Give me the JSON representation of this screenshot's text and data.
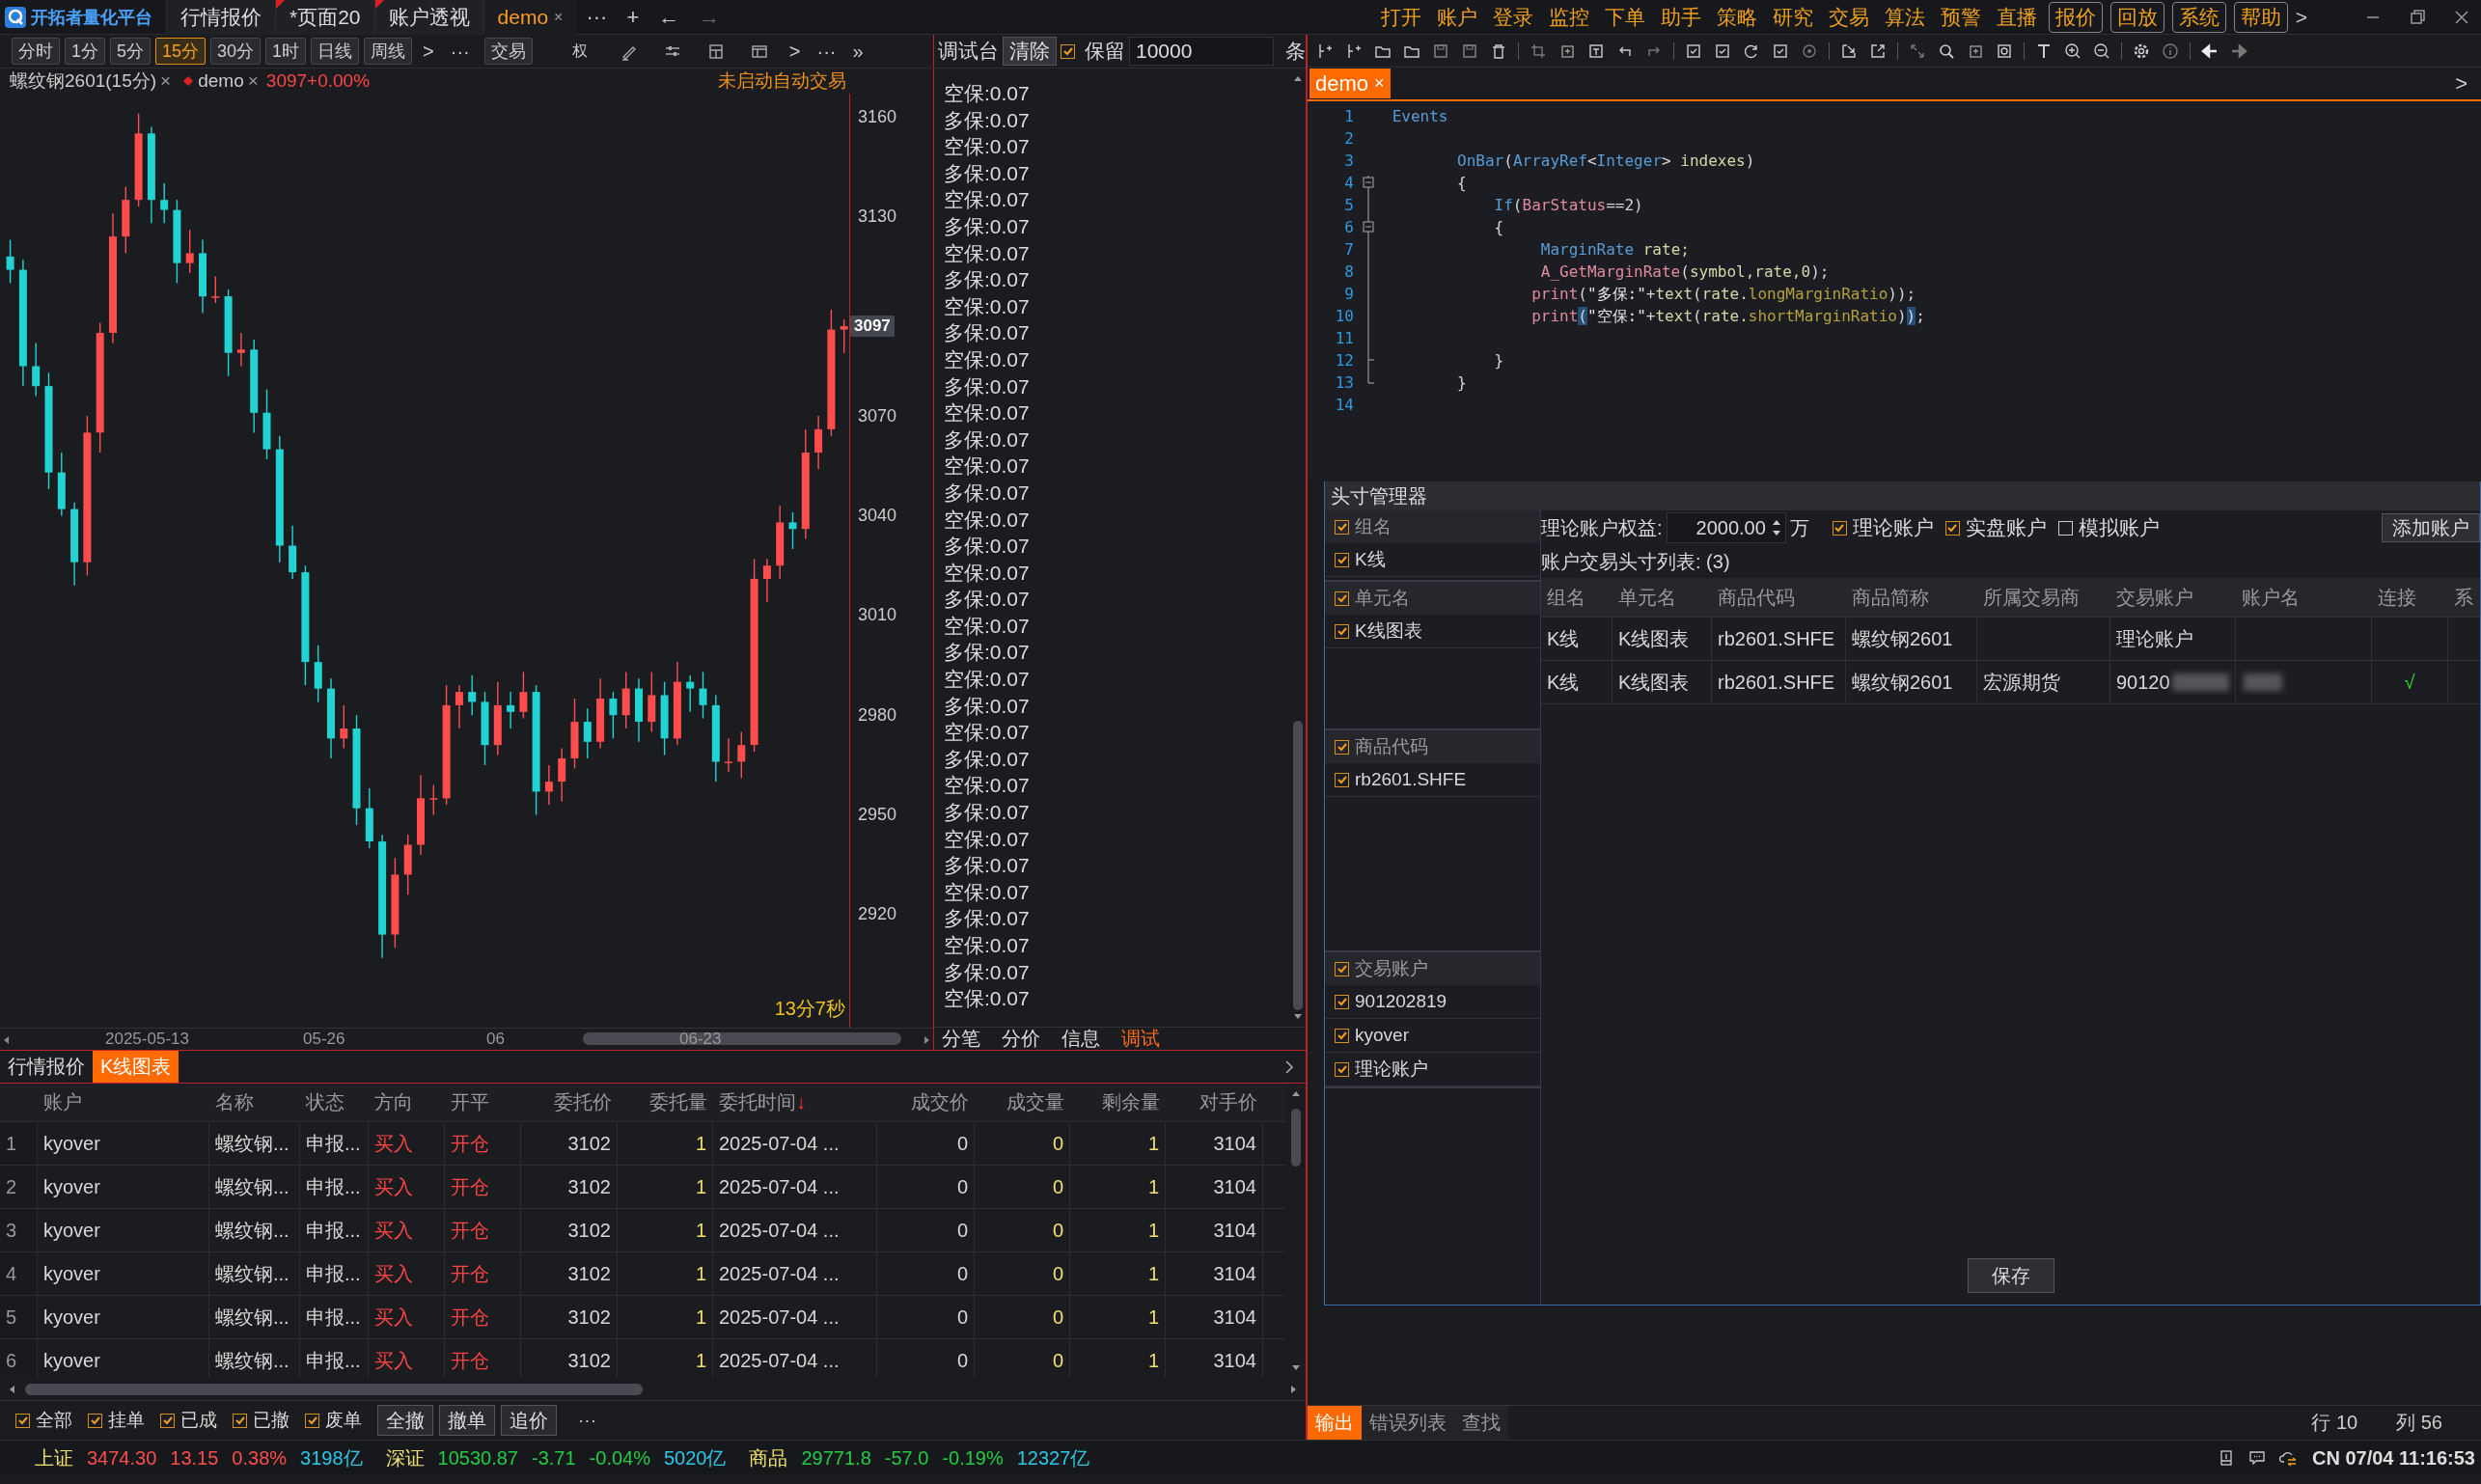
{
  "app": {
    "title": "开拓者量化平台"
  },
  "tabs": [
    {
      "label": "行情报价",
      "selected": false,
      "marked": false
    },
    {
      "label": "*页面20",
      "selected": false,
      "marked": true
    },
    {
      "label": "账户透视",
      "selected": false,
      "marked": true
    },
    {
      "label": "demo",
      "selected": true,
      "marked": false,
      "close": "×"
    }
  ],
  "tab_actions": [
    "···",
    "+",
    "←",
    "→"
  ],
  "menu": [
    {
      "label": "打开",
      "boxed": false
    },
    {
      "label": "账户",
      "boxed": false
    },
    {
      "label": "登录",
      "boxed": false
    },
    {
      "label": "监控",
      "boxed": false
    },
    {
      "label": "下单",
      "boxed": false
    },
    {
      "label": "助手",
      "boxed": false
    },
    {
      "label": "策略",
      "boxed": false
    },
    {
      "label": "研究",
      "boxed": false
    },
    {
      "label": "交易",
      "boxed": false
    },
    {
      "label": "算法",
      "boxed": false
    },
    {
      "label": "预警",
      "boxed": false
    },
    {
      "label": "直播",
      "boxed": false
    },
    {
      "label": "报价",
      "boxed": true
    },
    {
      "label": "回放",
      "boxed": true
    },
    {
      "label": "系统",
      "boxed": true
    },
    {
      "label": "帮助",
      "boxed": true
    }
  ],
  "menu_more": ">",
  "periods": [
    {
      "label": "分时",
      "selected": false
    },
    {
      "label": "1分",
      "selected": false
    },
    {
      "label": "5分",
      "selected": false
    },
    {
      "label": "15分",
      "selected": true
    },
    {
      "label": "30分",
      "selected": false
    },
    {
      "label": "1时",
      "selected": false
    },
    {
      "label": "日线",
      "selected": false
    },
    {
      "label": "周线",
      "selected": false
    }
  ],
  "chart_toolbar": {
    "more": [
      ">",
      "···"
    ],
    "trade": "交易",
    "weight": "权",
    "tail": [
      ">",
      "···",
      "»"
    ]
  },
  "debug_toolbar": {
    "title": "调试台",
    "clear": "清除",
    "keep": {
      "label": "保留",
      "checked": true
    },
    "limit": "10000",
    "unit": "条"
  },
  "chart": {
    "symbol": "螺纹钢2601(15分)",
    "close1": "×",
    "strategy": "demo",
    "close2": "×",
    "quote": "3097+0.00%",
    "auto_status": "未启动自动交易",
    "price_tag": "3097",
    "timer": "13分7秒",
    "x_labels": [
      "2025-05-13",
      "05-26",
      "06",
      "06-23"
    ],
    "chart_data": {
      "type": "candlestick",
      "ylim": [
        2886,
        3167
      ],
      "yticks": [
        {
          "value": 3160,
          "label": "3160"
        },
        {
          "value": 3130,
          "label": "3130"
        },
        {
          "value": 3070,
          "label": "3070"
        },
        {
          "value": 3040,
          "label": "3040"
        },
        {
          "value": 3010,
          "label": "3010"
        },
        {
          "value": 2980,
          "label": "2980"
        },
        {
          "value": 2950,
          "label": "2950"
        },
        {
          "value": 2920,
          "label": "2920"
        }
      ],
      "categories": [
        null,
        null,
        null,
        null,
        null,
        null,
        null,
        null,
        null,
        null,
        null,
        null,
        null,
        null,
        null,
        null,
        null,
        null,
        null,
        null,
        null,
        null,
        null,
        null,
        null,
        null,
        null,
        null,
        null,
        null,
        null,
        null,
        null,
        null,
        null,
        null,
        null,
        null,
        null,
        null,
        null,
        null,
        null,
        null,
        null,
        null,
        null,
        null,
        null,
        null,
        null,
        null,
        null,
        null,
        null,
        null,
        null,
        null,
        null,
        null,
        null,
        null,
        null,
        null,
        null,
        null
      ],
      "ohlc": [
        [
          3118,
          3123,
          3110,
          3114
        ],
        [
          3114,
          3117,
          3079,
          3085
        ],
        [
          3085,
          3092,
          3076,
          3079
        ],
        [
          3079,
          3083,
          3048,
          3053
        ],
        [
          3053,
          3059,
          3040,
          3042
        ],
        [
          3042,
          3044,
          3019,
          3026
        ],
        [
          3026,
          3070,
          3022,
          3065
        ],
        [
          3065,
          3098,
          3059,
          3095
        ],
        [
          3095,
          3131,
          3092,
          3124
        ],
        [
          3124,
          3139,
          3119,
          3135
        ],
        [
          3135,
          3161,
          3133,
          3155
        ],
        [
          3155,
          3157,
          3128,
          3135
        ],
        [
          3135,
          3140,
          3128,
          3132
        ],
        [
          3132,
          3135,
          3110,
          3116
        ],
        [
          3116,
          3126,
          3113,
          3119
        ],
        [
          3119,
          3123,
          3101,
          3106
        ],
        [
          3106,
          3112,
          3104,
          3106
        ],
        [
          3106,
          3108,
          3082,
          3089
        ],
        [
          3089,
          3095,
          3085,
          3090
        ],
        [
          3090,
          3093,
          3065,
          3071
        ],
        [
          3071,
          3078,
          3057,
          3060
        ],
        [
          3060,
          3064,
          3026,
          3031
        ],
        [
          3031,
          3037,
          3021,
          3023
        ],
        [
          3023,
          3025,
          2989,
          2996
        ],
        [
          2996,
          3001,
          2984,
          2988
        ],
        [
          2988,
          2991,
          2967,
          2973
        ],
        [
          2973,
          2983,
          2970,
          2976
        ],
        [
          2976,
          2980,
          2947,
          2952
        ],
        [
          2952,
          2958,
          2940,
          2942
        ],
        [
          2942,
          2944,
          2907,
          2914
        ],
        [
          2914,
          2937,
          2910,
          2932
        ],
        [
          2932,
          2944,
          2926,
          2941
        ],
        [
          2941,
          2962,
          2938,
          2955
        ],
        [
          2955,
          2959,
          2950,
          2955
        ],
        [
          2955,
          2989,
          2953,
          2983
        ],
        [
          2983,
          2989,
          2976,
          2987
        ],
        [
          2987,
          2992,
          2980,
          2984
        ],
        [
          2984,
          2987,
          2965,
          2971
        ],
        [
          2971,
          2990,
          2968,
          2983
        ],
        [
          2983,
          2987,
          2976,
          2981
        ],
        [
          2981,
          2993,
          2979,
          2987
        ],
        [
          2987,
          2989,
          2950,
          2957
        ],
        [
          2957,
          2965,
          2953,
          2960
        ],
        [
          2960,
          2970,
          2954,
          2967
        ],
        [
          2967,
          2985,
          2964,
          2978
        ],
        [
          2978,
          2982,
          2967,
          2972
        ],
        [
          2972,
          2991,
          2970,
          2985
        ],
        [
          2985,
          2987,
          2973,
          2980
        ],
        [
          2980,
          2993,
          2976,
          2988
        ],
        [
          2988,
          2991,
          2972,
          2978
        ],
        [
          2978,
          2993,
          2975,
          2986
        ],
        [
          2986,
          2990,
          2968,
          2973
        ],
        [
          2973,
          2996,
          2971,
          2990
        ],
        [
          2990,
          2992,
          2981,
          2988
        ],
        [
          2988,
          2993,
          2979,
          2983
        ],
        [
          2983,
          2986,
          2960,
          2966
        ],
        [
          2966,
          2973,
          2963,
          2966
        ],
        [
          2966,
          2975,
          2961,
          2971
        ],
        [
          2971,
          3027,
          2969,
          3021
        ],
        [
          3021,
          3027,
          3014,
          3025
        ],
        [
          3025,
          3043,
          3021,
          3038
        ],
        [
          3038,
          3041,
          3030,
          3036
        ],
        [
          3036,
          3066,
          3033,
          3059
        ],
        [
          3059,
          3070,
          3054,
          3066
        ],
        [
          3066,
          3102,
          3064,
          3096
        ],
        [
          3096,
          3099,
          3089,
          3097
        ]
      ]
    }
  },
  "debug_lines": [
    "空保:0.07",
    "多保:0.07",
    "空保:0.07",
    "多保:0.07",
    "空保:0.07",
    "多保:0.07",
    "空保:0.07",
    "多保:0.07",
    "空保:0.07",
    "多保:0.07",
    "空保:0.07",
    "多保:0.07",
    "空保:0.07",
    "多保:0.07",
    "空保:0.07",
    "多保:0.07",
    "空保:0.07",
    "多保:0.07",
    "空保:0.07",
    "多保:0.07",
    "空保:0.07",
    "多保:0.07",
    "空保:0.07",
    "多保:0.07",
    "空保:0.07",
    "多保:0.07",
    "空保:0.07",
    "多保:0.07",
    "空保:0.07",
    "多保:0.07",
    "空保:0.07",
    "多保:0.07",
    "空保:0.07",
    "多保:0.07",
    "空保:0.07"
  ],
  "debug_tabs": [
    {
      "label": "分笔",
      "selected": false
    },
    {
      "label": "分价",
      "selected": false
    },
    {
      "label": "信息",
      "selected": false
    },
    {
      "label": "调试",
      "selected": true
    }
  ],
  "bottom_tabs": [
    {
      "label": "行情报价",
      "selected": false
    },
    {
      "label": "K线图表",
      "selected": true
    }
  ],
  "orders": {
    "columns": [
      {
        "label": "账户"
      },
      {
        "label": "名称"
      },
      {
        "label": "状态"
      },
      {
        "label": "方向"
      },
      {
        "label": "开平"
      },
      {
        "label": "委托价"
      },
      {
        "label": "委托量"
      },
      {
        "label": "委托时间",
        "sort": "↓"
      },
      {
        "label": "成交价"
      },
      {
        "label": "成交量"
      },
      {
        "label": "剩余量"
      },
      {
        "label": "对手价"
      }
    ],
    "rows": [
      {
        "index": "1",
        "cells": [
          "kyover",
          "螺纹钢...",
          "申报...",
          "买入",
          "开仓",
          "3102",
          "1",
          "2025-07-04 ...",
          "0",
          "0",
          "1",
          "3104"
        ]
      },
      {
        "index": "2",
        "cells": [
          "kyover",
          "螺纹钢...",
          "申报...",
          "买入",
          "开仓",
          "3102",
          "1",
          "2025-07-04 ...",
          "0",
          "0",
          "1",
          "3104"
        ]
      },
      {
        "index": "3",
        "cells": [
          "kyover",
          "螺纹钢...",
          "申报...",
          "买入",
          "开仓",
          "3102",
          "1",
          "2025-07-04 ...",
          "0",
          "0",
          "1",
          "3104"
        ]
      },
      {
        "index": "4",
        "cells": [
          "kyover",
          "螺纹钢...",
          "申报...",
          "买入",
          "开仓",
          "3102",
          "1",
          "2025-07-04 ...",
          "0",
          "0",
          "1",
          "3104"
        ]
      },
      {
        "index": "5",
        "cells": [
          "kyover",
          "螺纹钢...",
          "申报...",
          "买入",
          "开仓",
          "3102",
          "1",
          "2025-07-04 ...",
          "0",
          "0",
          "1",
          "3104"
        ]
      },
      {
        "index": "6",
        "cells": [
          "kyover",
          "螺纹钢...",
          "申报...",
          "买入",
          "开仓",
          "3102",
          "1",
          "2025-07-04 ...",
          "0",
          "0",
          "1",
          "3104"
        ]
      }
    ]
  },
  "order_filters": [
    {
      "label": "全部",
      "checked": true
    },
    {
      "label": "挂单",
      "checked": true
    },
    {
      "label": "已成",
      "checked": true
    },
    {
      "label": "已撤",
      "checked": true
    },
    {
      "label": "废单",
      "checked": true
    }
  ],
  "order_buttons": [
    "全撤",
    "撤单",
    "追价"
  ],
  "order_more": "···",
  "market": [
    {
      "name": "上证",
      "price": "3474.30",
      "change": "13.15",
      "percent": "0.38%",
      "volume": "3198亿"
    },
    {
      "name": "深证",
      "price": "10530.87",
      "change": "-3.71",
      "percent": "-0.04%",
      "volume": "5020亿"
    },
    {
      "name": "商品",
      "price": "29771.8",
      "change": "-57.0",
      "percent": "-0.19%",
      "volume": "12327亿"
    }
  ],
  "editor": {
    "tab": {
      "label": "demo",
      "close": "×"
    },
    "more": ">",
    "lines": [
      {
        "no": "1",
        "parts": [
          {
            "kind": "kw",
            "text": " Events"
          }
        ]
      },
      {
        "no": "2"
      },
      {
        "no": "3",
        "parts": [
          {
            "kind": "kw",
            "text": "        OnBar"
          },
          {
            "kind": "op",
            "text": "("
          },
          {
            "kind": "kw",
            "text": "ArrayRef"
          },
          {
            "kind": "op",
            "text": "<"
          },
          {
            "kind": "kw",
            "text": "Integer"
          },
          {
            "kind": "op",
            "text": "> "
          },
          {
            "kind": "id",
            "text": "indexes"
          },
          {
            "kind": "op",
            "text": ")"
          }
        ]
      },
      {
        "no": "4",
        "parts": [
          {
            "kind": "op",
            "text": "        {"
          }
        ]
      },
      {
        "no": "5",
        "parts": [
          {
            "kind": "kw",
            "text": "            If"
          },
          {
            "kind": "op",
            "text": "("
          },
          {
            "kind": "fn",
            "text": "BarStatus"
          },
          {
            "kind": "op",
            "text": "==2)"
          }
        ]
      },
      {
        "no": "6",
        "parts": [
          {
            "kind": "op",
            "text": "            {"
          }
        ]
      },
      {
        "no": "7",
        "parts": [
          {
            "kind": "kw",
            "text": "                 MarginRate"
          },
          {
            "kind": "id",
            "text": " rate;"
          }
        ]
      },
      {
        "no": "8",
        "parts": [
          {
            "kind": "fn",
            "text": "                 A_GetMarginRate"
          },
          {
            "kind": "op",
            "text": "("
          },
          {
            "kind": "id",
            "text": "symbol,rate,0"
          },
          {
            "kind": "op",
            "text": ");"
          }
        ]
      },
      {
        "no": "9",
        "parts": [
          {
            "kind": "fn",
            "text": "                print"
          },
          {
            "kind": "op",
            "text": "("
          },
          {
            "kind": "str",
            "text": "\"多保:\""
          },
          {
            "kind": "op",
            "text": "+"
          },
          {
            "kind": "id",
            "text": "text"
          },
          {
            "kind": "op",
            "text": "("
          },
          {
            "kind": "id",
            "text": "rate."
          },
          {
            "kind": "prop",
            "text": "longMarginRatio"
          },
          {
            "kind": "op",
            "text": "));"
          }
        ]
      },
      {
        "no": "10",
        "parts": [
          {
            "kind": "fn",
            "text": "                print"
          },
          {
            "kind": "match",
            "text": "("
          },
          {
            "kind": "str",
            "text": "\"空保:\""
          },
          {
            "kind": "op",
            "text": "+"
          },
          {
            "kind": "id",
            "text": "text"
          },
          {
            "kind": "op",
            "text": "("
          },
          {
            "kind": "id",
            "text": "rate."
          },
          {
            "kind": "prop",
            "text": "shortMarginRatio"
          },
          {
            "kind": "op",
            "text": ")"
          },
          {
            "kind": "match",
            "text": ")"
          },
          {
            "kind": "op",
            "text": ";"
          }
        ]
      },
      {
        "no": "11"
      },
      {
        "no": "12",
        "parts": [
          {
            "kind": "op",
            "text": "            }"
          }
        ]
      },
      {
        "no": "13",
        "parts": [
          {
            "kind": "op",
            "text": "        }"
          }
        ]
      },
      {
        "no": "14"
      }
    ]
  },
  "positions": {
    "title": "头寸管理器",
    "groups": [
      {
        "label": "组名",
        "checked": true,
        "items": [
          {
            "label": "K线",
            "checked": true
          }
        ]
      },
      {
        "label": "单元名",
        "checked": true,
        "items": [
          {
            "label": "K线图表",
            "checked": true
          }
        ]
      },
      {
        "label": "商品代码",
        "checked": true,
        "items": [
          {
            "label": "rb2601.SHFE",
            "checked": true
          }
        ]
      },
      {
        "label": "交易账户",
        "checked": true,
        "items": [
          {
            "label": "901202819",
            "checked": true
          },
          {
            "label": "kyover",
            "checked": true
          },
          {
            "label": "理论账户",
            "checked": true
          }
        ]
      }
    ],
    "equity_label": "理论账户权益:",
    "equity": "2000.00",
    "equity_unit": "万",
    "filters": [
      {
        "label": "理论账户",
        "checked": true
      },
      {
        "label": "实盘账户",
        "checked": true
      },
      {
        "label": "模拟账户",
        "checked": false
      }
    ],
    "add_button": "添加账户",
    "list_title": "账户交易头寸列表: (3)",
    "columns": [
      "组名",
      "单元名",
      "商品代码",
      "商品简称",
      "所属交易商",
      "交易账户",
      "账户名",
      "连接",
      "系"
    ],
    "rows": [
      {
        "cells": [
          "K线",
          "K线图表",
          "rb2601.SHFE",
          "螺纹钢2601",
          null,
          "理论账户",
          null,
          null,
          null
        ]
      },
      {
        "cells": [
          "K线",
          "K线图表",
          "rb2601.SHFE",
          "螺纹钢2601",
          "宏源期货",
          "90120",
          null,
          "√",
          null
        ],
        "redacted": true
      }
    ],
    "save": "保存"
  },
  "output_tabs": [
    {
      "label": "输出",
      "selected": true
    },
    {
      "label": "错误列表",
      "selected": false
    },
    {
      "label": "查找",
      "selected": false
    }
  ],
  "cursor": {
    "line": "行 10",
    "column": "列 56"
  },
  "clock": "CN 07/04 11:16:53"
}
